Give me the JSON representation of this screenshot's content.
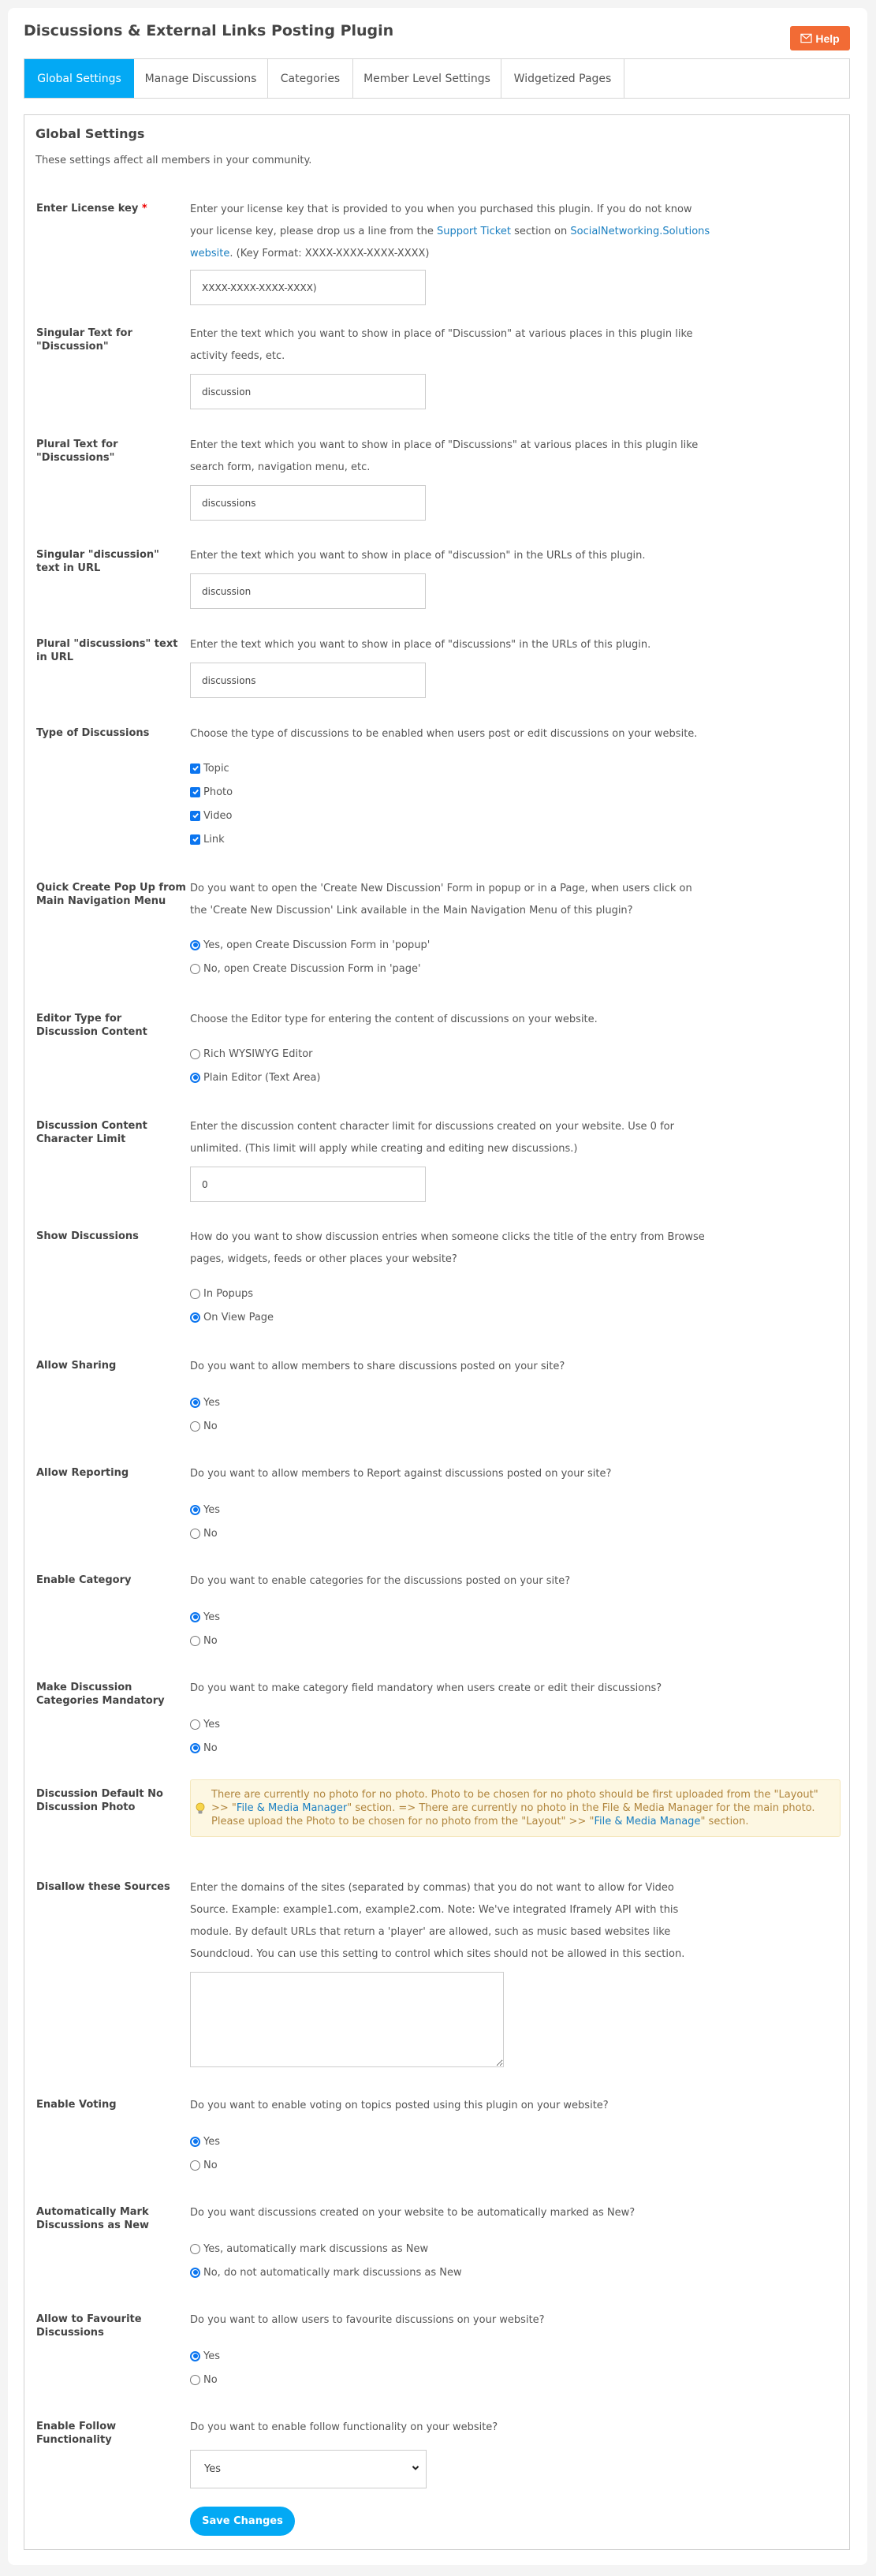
{
  "header": {
    "title": "Discussions & External Links Posting Plugin",
    "help_label": "Help"
  },
  "tabs": [
    {
      "label": "Global Settings",
      "active": true
    },
    {
      "label": "Manage Discussions",
      "active": false
    },
    {
      "label": "Categories",
      "active": false
    },
    {
      "label": "Member Level Settings",
      "active": false
    },
    {
      "label": "Widgetized Pages",
      "active": false
    }
  ],
  "form": {
    "title": "Global Settings",
    "intro": "These settings affect all members in your community.",
    "license": {
      "label": "Enter License key",
      "required_mark": "*",
      "desc_1": "Enter your license key that is provided to you when you purchased this plugin. If you do not know your license key, please drop us a line from the ",
      "link_support": "Support Ticket",
      "desc_2": " section on ",
      "link_site": "SocialNetworking.Solutions website",
      "desc_3": ". (Key Format: XXXX-XXXX-XXXX-XXXX)",
      "value": "XXXX-XXXX-XXXX-XXXX)"
    },
    "singular_text": {
      "label": "Singular Text for \"Discussion\"",
      "desc": "Enter the text which you want to show in place of \"Discussion\" at various places in this plugin like activity feeds, etc.",
      "value": "discussion"
    },
    "plural_text": {
      "label": "Plural Text for \"Discussions\"",
      "desc": "Enter the text which you want to show in place of \"Discussions\" at various places in this plugin like search form, navigation menu, etc.",
      "value": "discussions"
    },
    "singular_url": {
      "label": "Singular \"discussion\" text in URL",
      "desc": "Enter the text which you want to show in place of \"discussion\" in the URLs of this plugin.",
      "value": "discussion"
    },
    "plural_url": {
      "label": "Plural \"discussions\" text in URL",
      "desc": "Enter the text which you want to show in place of \"discussions\" in the URLs of this plugin.",
      "value": "discussions"
    },
    "types": {
      "label": "Type of Discussions",
      "desc": "Choose the type of discussions to be enabled when users post or edit discussions on your website.",
      "options": [
        {
          "label": "Topic",
          "checked": true
        },
        {
          "label": "Photo",
          "checked": true
        },
        {
          "label": "Video",
          "checked": true
        },
        {
          "label": "Link",
          "checked": true
        }
      ]
    },
    "quick_create": {
      "label": "Quick Create Pop Up from Main Navigation Menu",
      "desc": "Do you want to open the 'Create New Discussion' Form in popup or in a Page, when users click on the 'Create New Discussion' Link available in the Main Navigation Menu of this plugin?",
      "options": [
        {
          "label": "Yes, open Create Discussion Form in 'popup'",
          "selected": true
        },
        {
          "label": "No, open Create Discussion Form in 'page'",
          "selected": false
        }
      ]
    },
    "editor_type": {
      "label": "Editor Type for Discussion Content",
      "desc": "Choose the Editor type for entering the content of discussions on your website.",
      "options": [
        {
          "label": "Rich WYSIWYG Editor",
          "selected": false
        },
        {
          "label": "Plain Editor (Text Area)",
          "selected": true
        }
      ]
    },
    "char_limit": {
      "label": "Discussion Content Character Limit",
      "desc": "Enter the discussion content character limit for discussions created on your website. Use 0 for unlimited. (This limit will apply while creating and editing new discussions.)",
      "value": "0"
    },
    "show_discussions": {
      "label": "Show Discussions",
      "desc": "How do you want to show discussion entries when someone clicks the title of the entry from Browse pages, widgets, feeds or other places your website?",
      "options": [
        {
          "label": "In Popups",
          "selected": false
        },
        {
          "label": "On View Page",
          "selected": true
        }
      ]
    },
    "sharing": {
      "label": "Allow Sharing",
      "desc": "Do you want to allow members to share discussions posted on your site?",
      "options": [
        {
          "label": "Yes",
          "selected": true
        },
        {
          "label": "No",
          "selected": false
        }
      ]
    },
    "reporting": {
      "label": "Allow Reporting",
      "desc": "Do you want to allow members to Report against discussions posted on your site?",
      "options": [
        {
          "label": "Yes",
          "selected": true
        },
        {
          "label": "No",
          "selected": false
        }
      ]
    },
    "category": {
      "label": "Enable Category",
      "desc": "Do you want to enable categories for the discussions posted on your site?",
      "options": [
        {
          "label": "Yes",
          "selected": true
        },
        {
          "label": "No",
          "selected": false
        }
      ]
    },
    "category_mandatory": {
      "label": "Make Discussion Categories Mandatory",
      "desc": "Do you want to make category field mandatory when users create or edit their discussions?",
      "options": [
        {
          "label": "Yes",
          "selected": false
        },
        {
          "label": "No",
          "selected": true
        }
      ]
    },
    "default_photo": {
      "label": "Discussion Default No Discussion Photo",
      "tip_1": "There are currently no photo for no photo. Photo to be chosen for no photo should be first uploaded from the \"Layout\" >> \"",
      "tip_link_1": "File & Media Manager",
      "tip_2": "\" section. => There are currently no photo in the File & Media Manager for the main photo. Please upload the Photo to be chosen for no photo from the \"Layout\" >> \"",
      "tip_link_2": "File & Media Manage",
      "tip_3": "\" section."
    },
    "disallow_sources": {
      "label": "Disallow these Sources",
      "desc": "Enter the domains of the sites (separated by commas) that you do not want to allow for Video Source. Example: example1.com, example2.com. Note: We've integrated Iframely API with this module. By default URLs that return a 'player' are allowed, such as music based websites like Soundcloud. You can use this setting to control which sites should not be allowed in this section.",
      "value": ""
    },
    "voting": {
      "label": "Enable Voting",
      "desc": "Do you want to enable voting on topics posted using this plugin on your website?",
      "options": [
        {
          "label": "Yes",
          "selected": true
        },
        {
          "label": "No",
          "selected": false
        }
      ]
    },
    "mark_new": {
      "label": "Automatically Mark Discussions as New",
      "desc": "Do you want discussions created on your website to be automatically marked as New?",
      "options": [
        {
          "label": "Yes, automatically mark discussions as New",
          "selected": false
        },
        {
          "label": "No, do not automatically mark discussions as New",
          "selected": true
        }
      ]
    },
    "favourite": {
      "label": "Allow to Favourite Discussions",
      "desc": "Do you want to allow users to favourite discussions on your website?",
      "options": [
        {
          "label": "Yes",
          "selected": true
        },
        {
          "label": "No",
          "selected": false
        }
      ]
    },
    "follow": {
      "label": "Enable Follow Functionality",
      "desc": "Do you want to enable follow functionality on your website?",
      "selected": "Yes"
    },
    "save_label": "Save Changes"
  },
  "colors": {
    "accent": "#03a9f4",
    "help": "#f26b35",
    "link": "#1a7fc1",
    "tip_bg": "#fdf7e2",
    "tip_text": "#b0853d",
    "control": "#0b75ef"
  }
}
